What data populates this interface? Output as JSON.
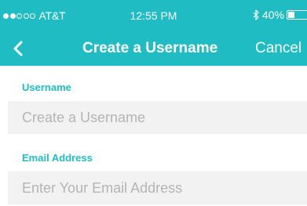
{
  "status_bar": {
    "signal_bars_filled": 2,
    "signal_bars_total": 5,
    "carrier": "AT&T",
    "time": "12:55 PM",
    "bluetooth_icon": "bluetooth-icon",
    "battery_percent": "40%",
    "battery_level": 0.4
  },
  "nav": {
    "back_icon": "chevron-left-icon",
    "title": "Create a Username",
    "cancel_label": "Cancel"
  },
  "form": {
    "username": {
      "label": "Username",
      "value": "",
      "placeholder": "Create a Username"
    },
    "email": {
      "label": "Email Address",
      "value": "",
      "placeholder": "Enter Your Email Address"
    }
  },
  "colors": {
    "accent": "#1fbcc3",
    "field_background": "#f2f2f2",
    "placeholder_text": "#b4b4b4"
  }
}
